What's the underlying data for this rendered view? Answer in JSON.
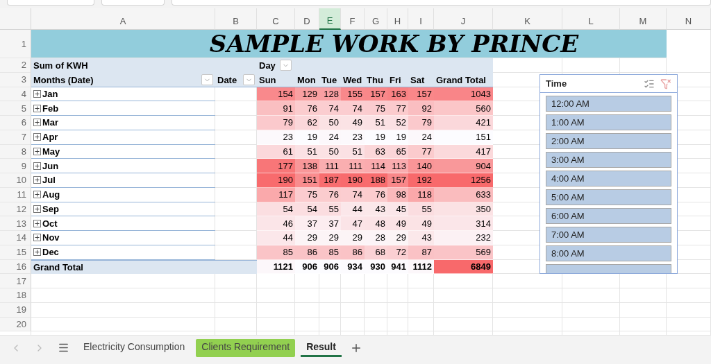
{
  "sheet": {
    "columns": [
      {
        "label": "A",
        "selected": false
      },
      {
        "label": "B",
        "selected": false
      },
      {
        "label": "C",
        "selected": false
      },
      {
        "label": "D",
        "selected": false
      },
      {
        "label": "E",
        "selected": true
      },
      {
        "label": "F",
        "selected": false
      },
      {
        "label": "G",
        "selected": false
      },
      {
        "label": "H",
        "selected": false
      },
      {
        "label": "I",
        "selected": false
      },
      {
        "label": "J",
        "selected": false
      },
      {
        "label": "K",
        "selected": false
      },
      {
        "label": "L",
        "selected": false
      },
      {
        "label": "M",
        "selected": false
      },
      {
        "label": "N",
        "selected": false
      }
    ],
    "row_numbers": [
      "1",
      "2",
      "3",
      "4",
      "5",
      "6",
      "7",
      "8",
      "9",
      "10",
      "11",
      "12",
      "13",
      "14",
      "15",
      "16",
      "17",
      "18",
      "19",
      "20"
    ]
  },
  "title": "SAMPLE WORK BY PRINCE",
  "pivot": {
    "value_label": "Sum of KWH",
    "column_field": "Day",
    "row_field": "Months (Date)",
    "date_field": "Date",
    "days": [
      "Sun",
      "Mon",
      "Tue",
      "Wed",
      "Thu",
      "Fri",
      "Sat"
    ],
    "total_header": "Grand Total",
    "rows": [
      {
        "label": "Jan",
        "expanded": false,
        "values": [
          "154",
          "129",
          "128",
          "155",
          "157",
          "163",
          "157"
        ],
        "total": "1043"
      },
      {
        "label": "Feb",
        "expanded": false,
        "values": [
          "91",
          "76",
          "74",
          "74",
          "75",
          "77",
          "92"
        ],
        "total": "560"
      },
      {
        "label": "Mar",
        "expanded": false,
        "values": [
          "79",
          "62",
          "50",
          "49",
          "51",
          "52",
          "79"
        ],
        "total": "421"
      },
      {
        "label": "Apr",
        "expanded": false,
        "values": [
          "23",
          "19",
          "24",
          "23",
          "19",
          "19",
          "24"
        ],
        "total": "151"
      },
      {
        "label": "May",
        "expanded": false,
        "values": [
          "61",
          "51",
          "50",
          "51",
          "63",
          "65",
          "77"
        ],
        "total": "417"
      },
      {
        "label": "Jun",
        "expanded": false,
        "values": [
          "177",
          "138",
          "111",
          "111",
          "114",
          "113",
          "140"
        ],
        "total": "904"
      },
      {
        "label": "Jul",
        "expanded": false,
        "values": [
          "190",
          "151",
          "187",
          "190",
          "188",
          "157",
          "192"
        ],
        "total": "1256"
      },
      {
        "label": "Aug",
        "expanded": false,
        "values": [
          "117",
          "75",
          "76",
          "74",
          "76",
          "98",
          "118"
        ],
        "total": "633"
      },
      {
        "label": "Sep",
        "expanded": false,
        "values": [
          "54",
          "54",
          "55",
          "44",
          "43",
          "45",
          "55"
        ],
        "total": "350"
      },
      {
        "label": "Oct",
        "expanded": false,
        "values": [
          "46",
          "37",
          "37",
          "47",
          "48",
          "49",
          "49"
        ],
        "total": "314"
      },
      {
        "label": "Nov",
        "expanded": false,
        "values": [
          "44",
          "29",
          "29",
          "29",
          "28",
          "29",
          "43"
        ],
        "total": "232"
      },
      {
        "label": "Dec",
        "expanded": false,
        "values": [
          "85",
          "86",
          "85",
          "86",
          "68",
          "72",
          "87"
        ],
        "total": "569"
      }
    ],
    "grand_total": {
      "label": "Grand Total",
      "values": [
        "1121",
        "906",
        "906",
        "934",
        "930",
        "941",
        "1112"
      ],
      "total": "6849"
    }
  },
  "slicer": {
    "title": "Time",
    "items": [
      {
        "label": "12:00 AM",
        "selected": true
      },
      {
        "label": "1:00 AM",
        "selected": true
      },
      {
        "label": "2:00 AM",
        "selected": true
      },
      {
        "label": "3:00 AM",
        "selected": true
      },
      {
        "label": "4:00 AM",
        "selected": true
      },
      {
        "label": "5:00 AM",
        "selected": true
      },
      {
        "label": "6:00 AM",
        "selected": true
      },
      {
        "label": "7:00 AM",
        "selected": true
      },
      {
        "label": "8:00 AM",
        "selected": true
      }
    ]
  },
  "sheet_tabs": [
    {
      "label": "Electricity Consumption",
      "selected": false
    },
    {
      "label": "Clients Requirement",
      "selected": false,
      "color": "#92d050"
    },
    {
      "label": "Result",
      "selected": true
    }
  ]
}
